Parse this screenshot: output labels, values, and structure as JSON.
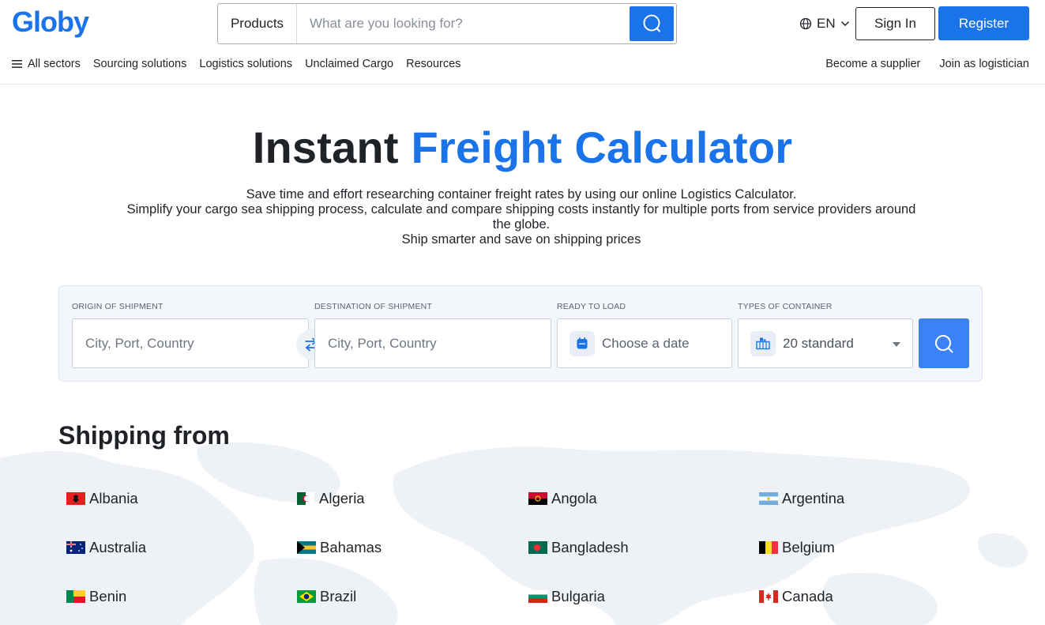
{
  "header": {
    "logo_text": "Globy",
    "search": {
      "category": "Products",
      "placeholder": "What are you looking for?"
    },
    "language": "EN",
    "sign_in": "Sign In",
    "register": "Register"
  },
  "nav": {
    "left": [
      "All sectors",
      "Sourcing solutions",
      "Logistics solutions",
      "Unclaimed Cargo",
      "Resources"
    ],
    "right": [
      "Become a supplier",
      "Join as logistician"
    ]
  },
  "hero": {
    "title_plain": "Instant",
    "title_accent": "Freight Calculator",
    "lines": [
      "Save time and effort researching container freight rates by using our online Logistics Calculator.",
      "Simplify your cargo sea shipping process, calculate and compare shipping costs instantly for multiple ports from service providers around the globe.",
      "Ship smarter and save on shipping prices"
    ]
  },
  "calculator": {
    "origin": {
      "label": "ORIGIN OF SHIPMENT",
      "placeholder": "City, Port, Country"
    },
    "destination": {
      "label": "DESTINATION OF SHIPMENT",
      "placeholder": "City, Port, Country"
    },
    "ready": {
      "label": "READY TO LOAD",
      "placeholder": "Choose a date"
    },
    "container": {
      "label": "TYPES OF CONTAINER",
      "value": "20 standard"
    }
  },
  "shipping_from": {
    "title": "Shipping from",
    "countries": [
      "Albania",
      "Algeria",
      "Angola",
      "Argentina",
      "Australia",
      "Bahamas",
      "Bangladesh",
      "Belgium",
      "Benin",
      "Brazil",
      "Bulgaria",
      "Canada"
    ]
  },
  "colors": {
    "brand": "#1a73e8",
    "panel": "#f3f6fb",
    "map": "#eef1f5"
  }
}
